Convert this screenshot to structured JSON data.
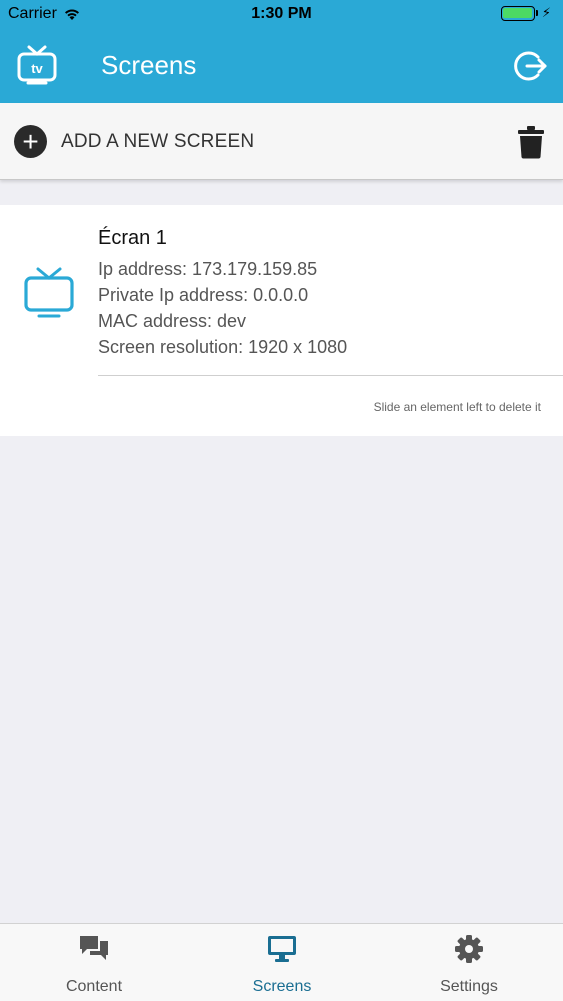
{
  "status_bar": {
    "carrier": "Carrier",
    "time": "1:30 PM",
    "battery_color": "#4cd964"
  },
  "nav": {
    "title": "Screens",
    "logo_icon": "tv-icon",
    "logout_icon": "logout-icon",
    "background": "#2aa9d6"
  },
  "actions": {
    "add_label": "ADD A NEW SCREEN",
    "delete_icon": "trash-icon"
  },
  "screens": [
    {
      "name": "Écran 1",
      "ip": "Ip address: 173.179.159.85",
      "private_ip": "Private Ip address: 0.0.0.0",
      "mac": "MAC address: dev",
      "resolution": "Screen resolution: 1920 x 1080",
      "icon": "tv-icon"
    }
  ],
  "hint": "Slide an element left to delete it",
  "tabs": [
    {
      "label": "Content",
      "icon": "chat-icon",
      "active": false
    },
    {
      "label": "Screens",
      "icon": "monitor-icon",
      "active": true
    },
    {
      "label": "Settings",
      "icon": "gear-icon",
      "active": false
    }
  ],
  "accent_color": "#1a6e92"
}
